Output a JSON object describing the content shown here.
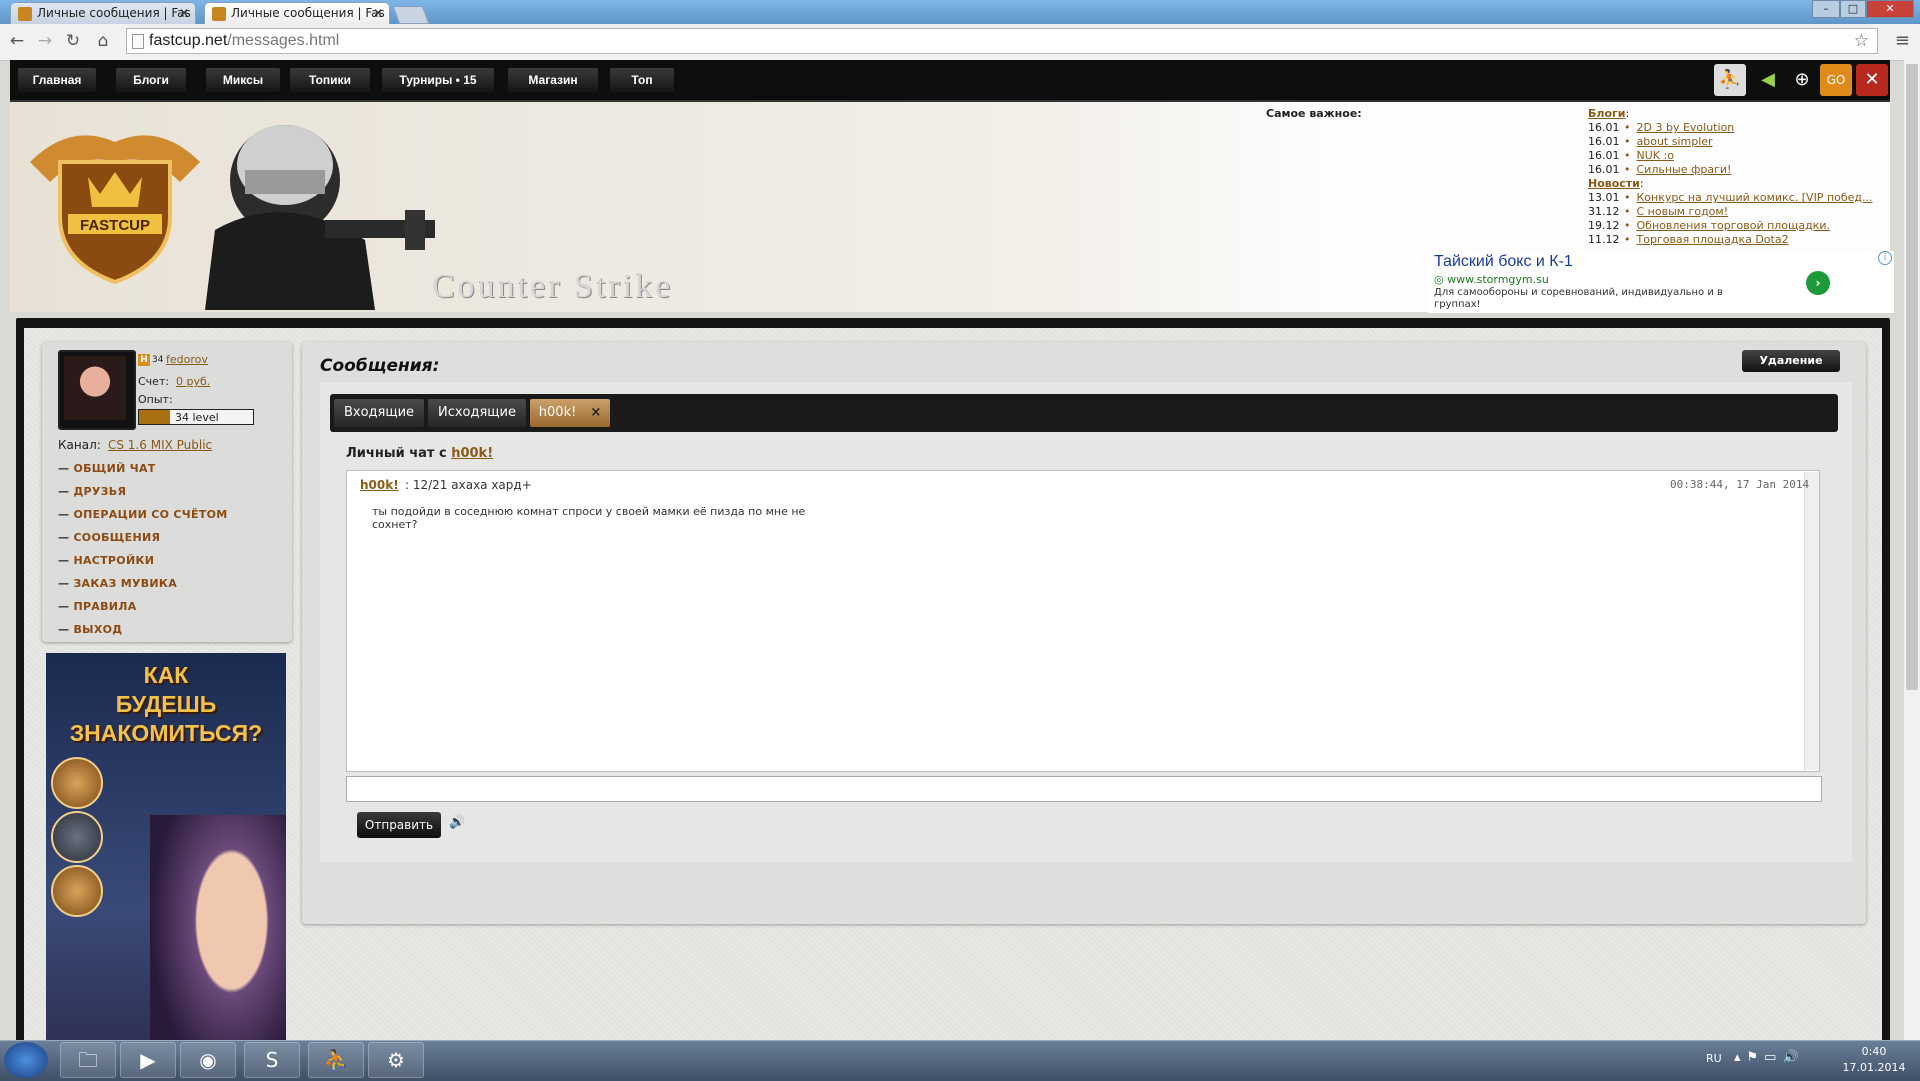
{
  "browser": {
    "tabs": [
      {
        "title": "Личные сообщения | Fas",
        "active": false
      },
      {
        "title": "Личные сообщения | Fas",
        "active": true
      }
    ],
    "url_domain": "fastcup.net",
    "url_path": "/messages.html",
    "window_buttons": [
      "–",
      "□",
      "✕"
    ]
  },
  "site_nav": {
    "items": [
      "Главная",
      "Блоги",
      "Миксы",
      "Топики",
      "Турниры • 15",
      "Магазин",
      "Топ"
    ],
    "game_icons": [
      "cs-icon",
      "arrow-icon",
      "crosshair-icon",
      "csgo-icon",
      "dota-icon"
    ]
  },
  "header": {
    "cs_text": "Counter Strike",
    "important_label": "Самое важное:",
    "blogs_heading": "Блоги",
    "blogs": [
      {
        "date": "16.01",
        "title": "2D 3 by Evolution"
      },
      {
        "date": "16.01",
        "title": "about simpler"
      },
      {
        "date": "16.01",
        "title": "NUK :o"
      },
      {
        "date": "16.01",
        "title": "Сильные фраги!"
      }
    ],
    "news_heading": "Новости",
    "news": [
      {
        "date": "13.01",
        "title": "Конкурс на лучший комикс. [VIP побед..."
      },
      {
        "date": "31.12",
        "title": "С новым годом!"
      },
      {
        "date": "19.12",
        "title": "Обновления торговой площадки."
      },
      {
        "date": "11.12",
        "title": "Торговая площадка Dota2"
      }
    ]
  },
  "ad": {
    "title": "Тайский бокс и К-1",
    "url": "www.stormgym.su",
    "desc": "Для самообороны и соревнований, индивидуально и в группах!",
    "go": "›",
    "info": "i"
  },
  "user": {
    "rank_badge": "H",
    "rank_num": "34",
    "name": "fedorov",
    "score_label": "Счет:",
    "score_value": "0 руб.",
    "exp_label": "Опыт:",
    "level": "34 level",
    "level_progress": 0.27,
    "channel_label": "Канал:",
    "channel": "CS 1.6 MIX Public"
  },
  "user_menu": [
    "ОБЩИЙ ЧАТ",
    "ДРУЗЬЯ",
    "ОПЕРАЦИИ СО СЧЁТОМ",
    "СООБЩЕНИЯ",
    "НАСТРОЙКИ",
    "ЗАКАЗ МУВИКА",
    "ПРАВИЛА",
    "ВЫХОД"
  ],
  "promo": {
    "text_l1": "КАК",
    "text_l2": "БУДЕШЬ",
    "text_l3": "ЗНАКОМИТЬСЯ?"
  },
  "messages": {
    "title": "Сообщения:",
    "delete_label": "Удаление",
    "tabs": [
      {
        "label": "Входящие"
      },
      {
        "label": "Исходящие"
      },
      {
        "label": "h00k!",
        "close": "×"
      }
    ],
    "chat_label": "Личный чат с",
    "chat_user": "h00k!",
    "message": {
      "sender": "h00k!",
      "status": ": 12/21 ахаха хард+",
      "time": "00:38:44, 17 Jan 2014",
      "text": "ты подойди в соседнюю комнат спроси у своей мамки её пизда по мне не сохнет?"
    },
    "send_label": "Отправить",
    "sound_icon": "🔊"
  },
  "taskbar": {
    "lang": "RU",
    "time": "0:40",
    "date": "17.01.2014",
    "apps": [
      "folder-icon",
      "media-player-icon",
      "chrome-icon",
      "skype-icon",
      "cs-icon",
      "steam-icon"
    ]
  }
}
